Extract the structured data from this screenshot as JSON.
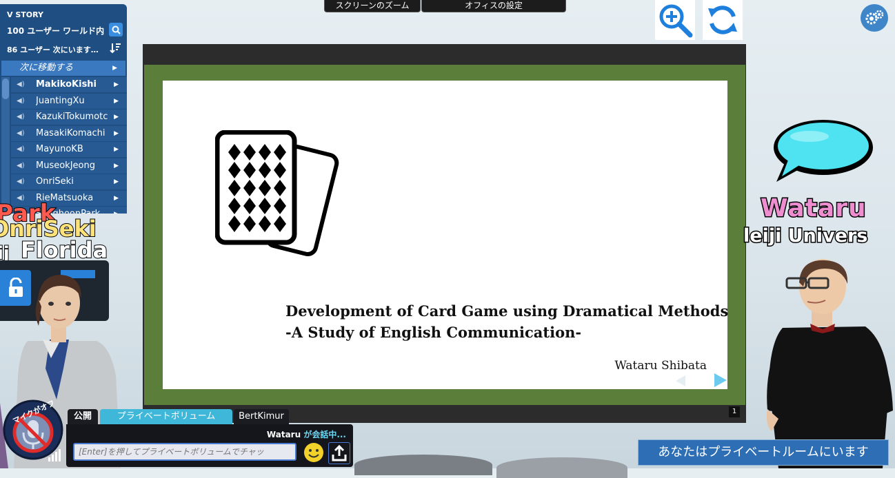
{
  "top_tabs": {
    "zoom": "スクリーンのズーム",
    "office_settings": "オフィスの設定"
  },
  "user_panel": {
    "title": "V STORY",
    "world_count": "100 ユーザー ワールド内",
    "next_count": "86 ユーザー 次にいます…",
    "move_next": "次に移動する",
    "users": [
      "MakikoKishi",
      "JuantingXu",
      "KazukiTokumotc",
      "MasakiKomachi",
      "MayunoKB",
      "MuseokJeong",
      "OnriSeki",
      "RieMatsuoka",
      "SanghoonPark"
    ]
  },
  "floating_names": {
    "name1": "Park",
    "name2": "OnriSeki",
    "name3": "Florida",
    "name4": "ij"
  },
  "slide": {
    "title": "Development of Card Game using Dramatical Methods",
    "subtitle": "-A Study of English Communication-",
    "author": "Wataru Shibata",
    "page": "1"
  },
  "avatar": {
    "name": "Wataru",
    "affiliation": "leiji Univers"
  },
  "private_notice": "あなたはプライベートルームにいます",
  "chat": {
    "mic_label": "マイクがオフ",
    "tabs": {
      "public": "公開",
      "private_volume": "プライベートボリューム",
      "user": "BertKimur"
    },
    "talking_user": "Wataru",
    "talking_suffix": "が会話中...",
    "placeholder": "[Enter]を押してプライベートボリュームでチャッ"
  },
  "colors": {
    "panel": "#1f4f82",
    "accent": "#3a78bf",
    "slide_border": "#5b7f3a",
    "name_pink": "#ef8dd1"
  }
}
